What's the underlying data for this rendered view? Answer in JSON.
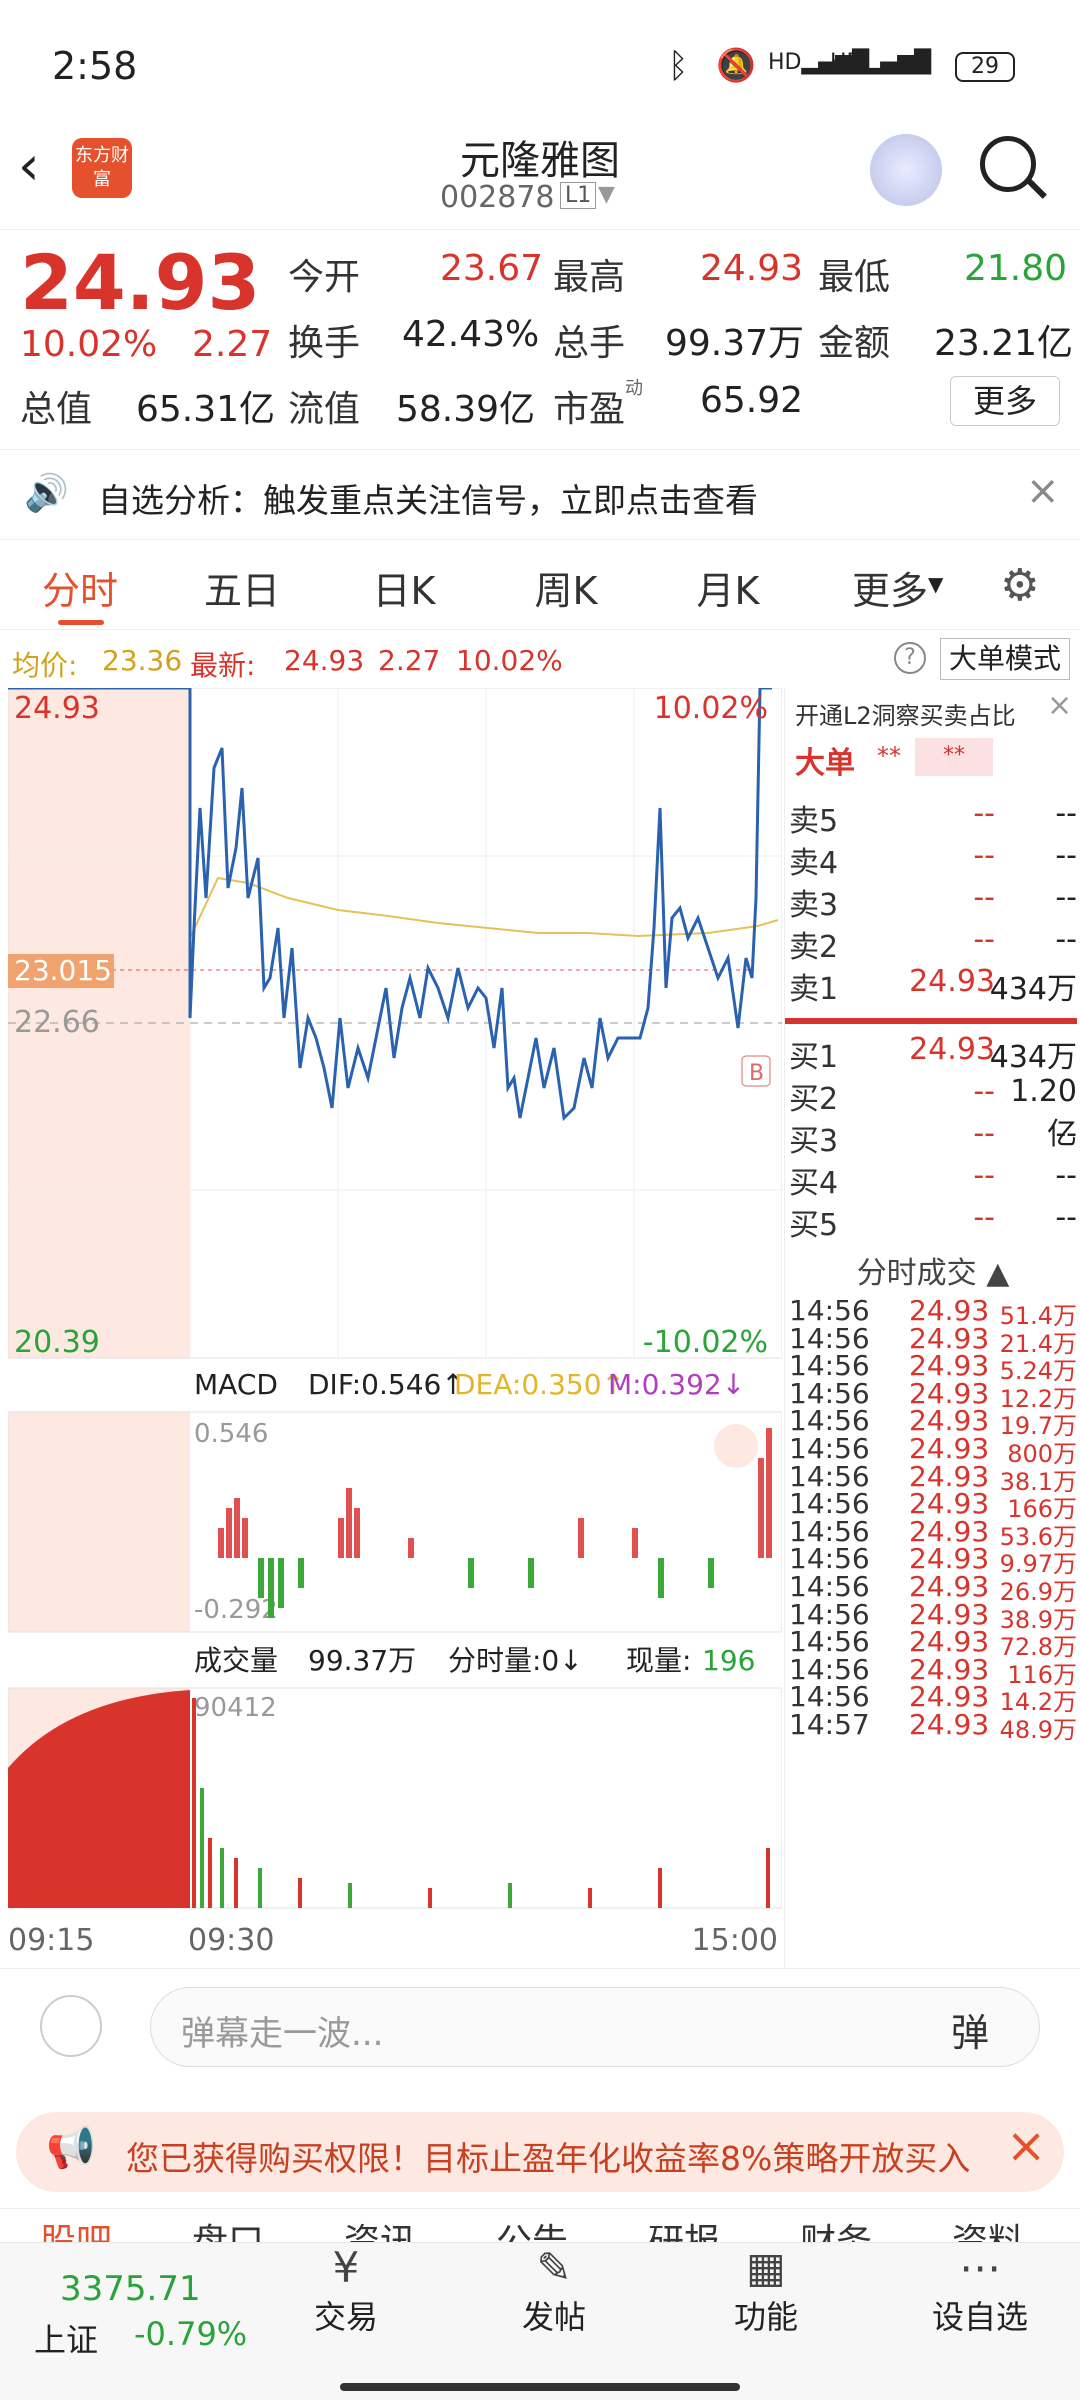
{
  "status": {
    "time": "2:58",
    "battery": "29"
  },
  "header": {
    "title": "元隆雅图",
    "code": "002878",
    "level": "L1",
    "logo": "东方财富"
  },
  "quote": {
    "price": "24.93",
    "pct": "10.02%",
    "chg": "2.27",
    "today_open_label": "今开",
    "today_open": "23.67",
    "high_label": "最高",
    "high": "24.93",
    "low_label": "最低",
    "low": "21.80",
    "turnover_label": "换手",
    "turnover": "42.43%",
    "volume_label": "总手",
    "volume": "99.37万",
    "amount_label": "金额",
    "amount": "23.21亿",
    "mcap_label": "总值",
    "mcap": "65.31亿",
    "float_label": "流值",
    "float": "58.39亿",
    "pe_label": "市盈",
    "pe_sup": "动",
    "pe": "65.92",
    "more": "更多"
  },
  "alert": {
    "text": "自选分析：触发重点关注信号，立即点击查看"
  },
  "tabs": [
    "分时",
    "五日",
    "日K",
    "周K",
    "月K",
    "更多"
  ],
  "chart_info": {
    "avg_label": "均价:",
    "avg": "23.36",
    "last_label": "最新:",
    "last": "24.93",
    "chg": "2.27",
    "pct": "10.02%",
    "mode": "大单模式"
  },
  "main_chart": {
    "hi": "24.93",
    "hi_pct": "10.02%",
    "lo": "20.39",
    "lo_pct": "-10.02%",
    "ref": "22.66",
    "cur": "23.015",
    "marker": "B"
  },
  "macd": {
    "label": "MACD",
    "dif": "DIF:0.546↑",
    "dea": "DEA:0.350↑",
    "m": "M:0.392↓",
    "top": "0.546",
    "bot": "-0.292"
  },
  "vol": {
    "label": "成交量",
    "total": "99.37万",
    "fs_label": "分时量:0↓",
    "now_label": "现量:",
    "now": "196",
    "max": "90412"
  },
  "time_axis": {
    "t1": "09:15",
    "t2": "09:30",
    "t3": "15:00"
  },
  "right": {
    "l2": "开通L2洞察买卖占比",
    "big": "大单",
    "star": "**",
    "sell": [
      {
        "l": "卖5",
        "p": "--",
        "v": "--"
      },
      {
        "l": "卖4",
        "p": "--",
        "v": "--"
      },
      {
        "l": "卖3",
        "p": "--",
        "v": "--"
      },
      {
        "l": "卖2",
        "p": "--",
        "v": "--"
      },
      {
        "l": "卖1",
        "p": "24.93",
        "v": "434万"
      }
    ],
    "buy": [
      {
        "l": "买1",
        "p": "24.93",
        "v": "434万"
      },
      {
        "l": "买2",
        "p": "--",
        "v": "1.20亿"
      },
      {
        "l": "买3",
        "p": "--",
        "v": "--"
      },
      {
        "l": "买4",
        "p": "--",
        "v": "--"
      },
      {
        "l": "买5",
        "p": "--",
        "v": "--"
      }
    ],
    "trades_title": "分时成交",
    "trades": [
      {
        "t": "14:56",
        "p": "24.93",
        "v": "51.4万"
      },
      {
        "t": "14:56",
        "p": "24.93",
        "v": "21.4万"
      },
      {
        "t": "14:56",
        "p": "24.93",
        "v": "5.24万"
      },
      {
        "t": "14:56",
        "p": "24.93",
        "v": "12.2万"
      },
      {
        "t": "14:56",
        "p": "24.93",
        "v": "19.7万"
      },
      {
        "t": "14:56",
        "p": "24.93",
        "v": "800万"
      },
      {
        "t": "14:56",
        "p": "24.93",
        "v": "38.1万"
      },
      {
        "t": "14:56",
        "p": "24.93",
        "v": "166万"
      },
      {
        "t": "14:56",
        "p": "24.93",
        "v": "53.6万"
      },
      {
        "t": "14:56",
        "p": "24.93",
        "v": "9.97万"
      },
      {
        "t": "14:56",
        "p": "24.93",
        "v": "26.9万"
      },
      {
        "t": "14:56",
        "p": "24.93",
        "v": "38.9万"
      },
      {
        "t": "14:56",
        "p": "24.93",
        "v": "72.8万"
      },
      {
        "t": "14:56",
        "p": "24.93",
        "v": "116万"
      },
      {
        "t": "14:56",
        "p": "24.93",
        "v": "14.2万"
      },
      {
        "t": "14:57",
        "p": "24.93",
        "v": "48.9万"
      }
    ]
  },
  "comment": {
    "placeholder": "弹幕走一波...",
    "btn": "弹"
  },
  "promo": {
    "text": "您已获得购买权限！目标止盈年化收益率8%策略开放买入"
  },
  "subtabs": [
    "股吧",
    "盘口",
    "资讯",
    "公告",
    "研报",
    "财务",
    "资料"
  ],
  "bottom": {
    "index": "3375.71",
    "index_name": "上证",
    "index_pct": "-0.79%",
    "trade": "交易",
    "post": "发帖",
    "func": "功能",
    "watch": "设自选"
  },
  "chart_data": {
    "type": "line",
    "title": "分时",
    "series": [
      {
        "name": "最新",
        "values": [
          24.93,
          22.66,
          24.5,
          23.5,
          23.3,
          22.8,
          22.6,
          23.1,
          22.7,
          22.3,
          22.5,
          22.9,
          24.1,
          23.6,
          24.93
        ]
      },
      {
        "name": "均价",
        "values": [
          23.5,
          23.4,
          23.35,
          23.3,
          23.28,
          23.25,
          23.27,
          23.3,
          23.32,
          23.36
        ]
      }
    ],
    "ylim": [
      20.39,
      24.93
    ]
  }
}
